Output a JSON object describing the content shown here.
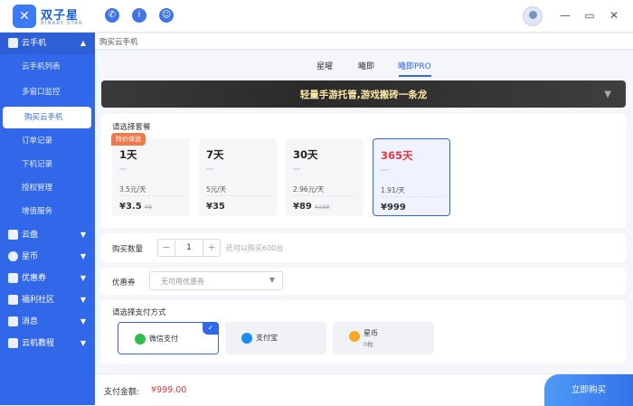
{
  "app": {
    "brand": "双子星",
    "brand_sub": "BINARY STAR",
    "badge": "云手机"
  },
  "topbar": {
    "icons": [
      "phone-icon",
      "info-icon",
      "service-icon"
    ],
    "minimize": "—",
    "maximize": "▭",
    "close": "✕"
  },
  "sidebar": {
    "sections": [
      {
        "label": "云手机",
        "icon": "phone-icon",
        "open": true
      },
      {
        "label": "云盘",
        "icon": "cloud-disk-icon"
      },
      {
        "label": "星币",
        "icon": "coin-icon"
      },
      {
        "label": "优惠券",
        "icon": "coupon-icon"
      },
      {
        "label": "福利社区",
        "icon": "gift-icon"
      },
      {
        "label": "消息",
        "icon": "message-icon"
      },
      {
        "label": "云机教程",
        "icon": "tutorial-icon"
      }
    ],
    "sub_items": [
      "云手机列表",
      "多窗口监控",
      "购买云手机",
      "订单记录",
      "下机记录",
      "授权管理",
      "增值服务"
    ],
    "active_sub": "购买云手机"
  },
  "breadcrumb": "购买云手机",
  "tabs": [
    "星曜",
    "曦即",
    "曦即PRO"
  ],
  "active_tab": "曦即PRO",
  "banner": {
    "text": "轻量手游托管,游戏搬砖一条龙"
  },
  "packages": {
    "title": "请选择套餐",
    "promo_tag": "特价体验",
    "items": [
      {
        "days": "1天",
        "dash": "—",
        "price": "3.5元/天",
        "total": "¥3.5",
        "original": "¥9"
      },
      {
        "days": "7天",
        "dash": "—",
        "price": "5元/天",
        "total": "¥35",
        "original": ""
      },
      {
        "days": "30天",
        "dash": "—",
        "price": "2.96元/天",
        "total": "¥89",
        "original": "¥168"
      },
      {
        "days": "365天",
        "dash": "—",
        "price": "1.91/天",
        "total": "¥999",
        "original": ""
      }
    ],
    "selected_index": 3
  },
  "quantity": {
    "label": "购买数量",
    "minus": "−",
    "value": "1",
    "plus": "+",
    "hint": "还可以购买600台"
  },
  "coupon": {
    "label": "优惠券",
    "placeholder": "无可用优惠券"
  },
  "payment": {
    "title": "请选择支付方式",
    "methods": [
      {
        "label": "微信支付",
        "sub": "",
        "color": "#2fbf4a"
      },
      {
        "label": "支付宝",
        "sub": "",
        "color": "#1b8cf0"
      },
      {
        "label": "星币",
        "sub": "0枚",
        "color": "#f7a928"
      }
    ],
    "selected_index": 0,
    "check": "✓"
  },
  "footer": {
    "label": "支付金额:",
    "amount": "¥999.00",
    "button": "立即购买"
  },
  "colors": {
    "accent": "#3168ea",
    "price_red": "#e8353c",
    "promo": "#f27a4a"
  }
}
